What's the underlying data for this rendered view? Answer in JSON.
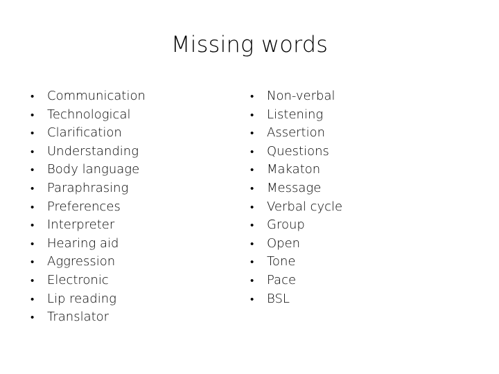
{
  "slide": {
    "title": "Missing words",
    "background_color": "#ffffff",
    "text_color": "#000000",
    "bullet_glyph": "•"
  },
  "columns": {
    "left": {
      "items": [
        "Communication",
        "Technological",
        "Clarification",
        "Understanding",
        "Body language",
        "Paraphrasing",
        "Preferences",
        "Interpreter",
        "Hearing aid",
        "Aggression",
        "Electronic",
        "Lip reading",
        "Translator"
      ]
    },
    "right": {
      "items": [
        "Non-verbal",
        "Listening",
        "Assertion",
        "Questions",
        "Makaton",
        "Message",
        "Verbal cycle",
        "Group",
        "Open",
        "Tone",
        "Pace",
        "BSL"
      ]
    }
  }
}
